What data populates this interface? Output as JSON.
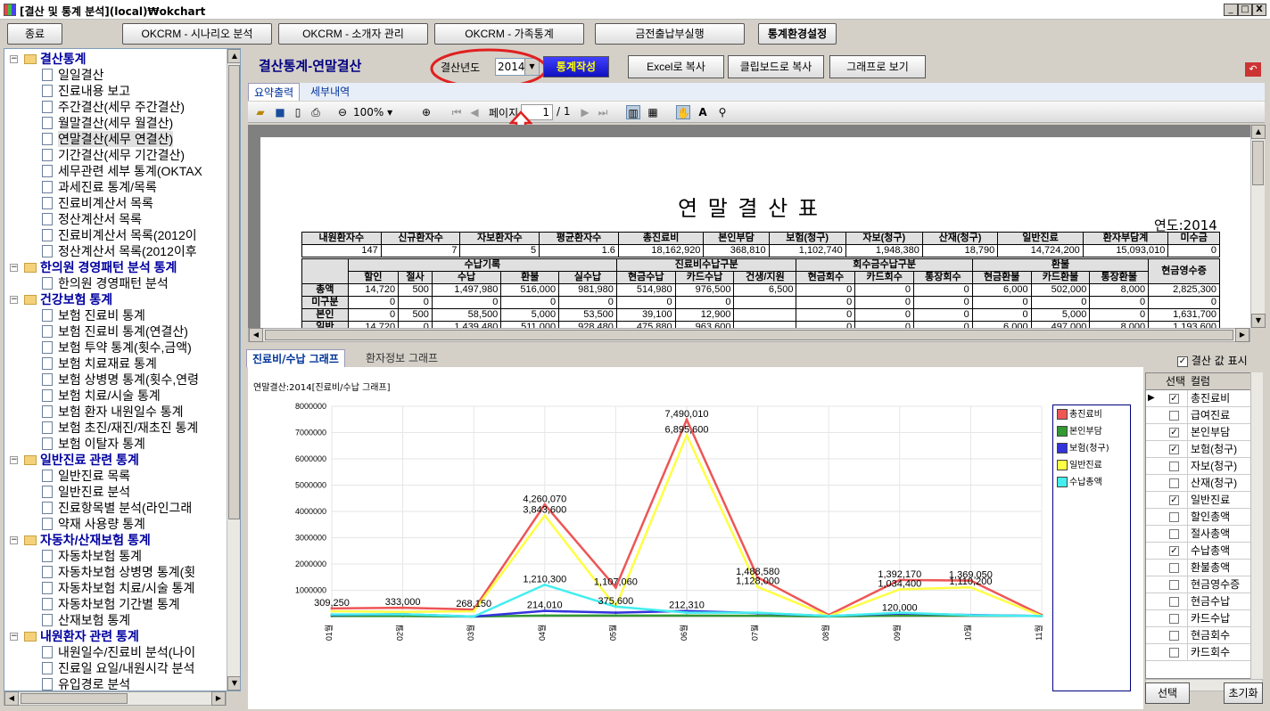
{
  "window": {
    "title": "[결산 및 통계 분석](local)₩okchart",
    "min": "_",
    "max": "□",
    "close": "X"
  },
  "topbar": {
    "exit": "종료",
    "scenario": "OKCRM - 시나리오 분석",
    "referrer": "OKCRM - 소개자 관리",
    "family": "OKCRM - 가족통계",
    "cash": "금전출납부실행",
    "settings": "통계환경설정"
  },
  "tree": [
    {
      "label": "결산통계",
      "level": 0
    },
    {
      "label": "일일결산",
      "level": 1
    },
    {
      "label": "진료내용 보고",
      "level": 1
    },
    {
      "label": "주간결산(세무 주간결산)",
      "level": 1
    },
    {
      "label": "월말결산(세무 월결산)",
      "level": 1
    },
    {
      "label": "연말결산(세무 연결산)",
      "level": 1,
      "selected": true
    },
    {
      "label": "기간결산(세무 기간결산)",
      "level": 1
    },
    {
      "label": "세무관련 세부 통계(OKTAX",
      "level": 1
    },
    {
      "label": "과세진료 통계/목록",
      "level": 1
    },
    {
      "label": "진료비계산서 목록",
      "level": 1
    },
    {
      "label": "정산계산서 목록",
      "level": 1
    },
    {
      "label": "진료비계산서 목록(2012이",
      "level": 1
    },
    {
      "label": "정산계산서 목록(2012이후",
      "level": 1
    },
    {
      "label": "한의원 경영패턴 분석 통계",
      "level": 0
    },
    {
      "label": "한의원 경영패턴 분석",
      "level": 1
    },
    {
      "label": "건강보험 통계",
      "level": 0
    },
    {
      "label": "보험 진료비 통계",
      "level": 1
    },
    {
      "label": "보험 진료비 통계(연결산)",
      "level": 1
    },
    {
      "label": "보험 투약 통계(횟수,금액)",
      "level": 1
    },
    {
      "label": "보험 치료재료 통계",
      "level": 1
    },
    {
      "label": "보험 상병명 통계(횟수,연령",
      "level": 1
    },
    {
      "label": "보험 치료/시술 통계",
      "level": 1
    },
    {
      "label": "보험 환자 내원일수 통계",
      "level": 1
    },
    {
      "label": "보험 초진/재진/재초진 통계",
      "level": 1
    },
    {
      "label": "보험 이탈자 통계",
      "level": 1
    },
    {
      "label": "일반진료 관련 통계",
      "level": 0
    },
    {
      "label": "일반진료 목록",
      "level": 1
    },
    {
      "label": "일반진료 분석",
      "level": 1
    },
    {
      "label": "진료항목별 분석(라인그래",
      "level": 1
    },
    {
      "label": "약재 사용량 통계",
      "level": 1
    },
    {
      "label": "자동차/산재보험 통계",
      "level": 0
    },
    {
      "label": "자동차보험 통계",
      "level": 1
    },
    {
      "label": "자동차보험 상병명 통계(횟",
      "level": 1
    },
    {
      "label": "자동차보험 치료/시술 통계",
      "level": 1
    },
    {
      "label": "자동차보험 기간별 통계",
      "level": 1
    },
    {
      "label": "산재보험 통계",
      "level": 1
    },
    {
      "label": "내원환자 관련 통계",
      "level": 0
    },
    {
      "label": "내원일수/진료비 분석(나이",
      "level": 1
    },
    {
      "label": "진료일 요일/내원시각 분석",
      "level": 1
    },
    {
      "label": "유입경로 분석",
      "level": 1
    }
  ],
  "header": {
    "title": "결산통계-연말결산",
    "year_label": "결산년도",
    "year_value": "2014",
    "make": "통계작성",
    "excel": "Excel로 복사",
    "clipboard": "클립보드로 복사",
    "graph": "그래프로 보기"
  },
  "report_tabs": [
    "요약출력",
    "세부내역"
  ],
  "viewer": {
    "zoom": "100%",
    "page_label": "페이지",
    "page_value": "1",
    "page_total": "/ 1"
  },
  "report": {
    "title": "연 말 결 산 표",
    "year": "연도:2014",
    "sum_headers": [
      "내원환자수",
      "신규환자수",
      "자보환자수",
      "평균환자수",
      "총진료비",
      "본인부담",
      "보험(청구)",
      "자보(청구)",
      "산재(청구)",
      "일반진료",
      "환자부담계",
      "미수금"
    ],
    "sum_values": [
      "147",
      "7",
      "5",
      "1.6",
      "18,162,920",
      "368,810",
      "1,102,740",
      "1,948,380",
      "18,790",
      "14,724,200",
      "15,093,010",
      "0"
    ],
    "group_headers": [
      "수납기록",
      "진료비수납구분",
      "회수금수납구분",
      "환불",
      "현금영수증"
    ],
    "sub_headers": [
      "할인",
      "절사",
      "수납",
      "환불",
      "실수납",
      "현금수납",
      "카드수납",
      "건생/지원",
      "현금회수",
      "카드회수",
      "통장회수",
      "현금환불",
      "카드환불",
      "통장환불"
    ],
    "rows": [
      {
        "label": "총액",
        "values": [
          "14,720",
          "500",
          "1,497,980",
          "516,000",
          "981,980",
          "514,980",
          "976,500",
          "6,500",
          "0",
          "0",
          "0",
          "6,000",
          "502,000",
          "8,000",
          "2,825,300"
        ]
      },
      {
        "label": "미구분",
        "values": [
          "0",
          "0",
          "0",
          "0",
          "0",
          "0",
          "0",
          "",
          "0",
          "0",
          "0",
          "0",
          "0",
          "0",
          "0"
        ]
      },
      {
        "label": "본인",
        "values": [
          "0",
          "500",
          "58,500",
          "5,000",
          "53,500",
          "39,100",
          "12,900",
          "",
          "0",
          "0",
          "0",
          "0",
          "5,000",
          "0",
          "1,631,700"
        ]
      },
      {
        "label": "일반",
        "values": [
          "14,720",
          "0",
          "1,439,480",
          "511,000",
          "928,480",
          "475,880",
          "963,600",
          "",
          "0",
          "0",
          "0",
          "6,000",
          "497,000",
          "8,000",
          "1,193,600"
        ]
      }
    ]
  },
  "chart_tabs": [
    "진료비/수납 그래프",
    "환자정보 그래프"
  ],
  "show_values_label": "결산 값 표시",
  "chart_data": {
    "type": "line",
    "title": "연말결산:2014[진료비/수납 그래프]",
    "categories": [
      "01월",
      "02월",
      "03월",
      "04월",
      "05월",
      "06월",
      "07월",
      "08월",
      "09월",
      "10월",
      "11월"
    ],
    "ylim": [
      0,
      8000000
    ],
    "yticks": [
      "1000000",
      "2000000",
      "3000000",
      "4000000",
      "5000000",
      "6000000",
      "7000000",
      "8000000"
    ],
    "series": [
      {
        "name": "총진료비",
        "color": "#ee5555",
        "values": [
          309250,
          333000,
          268150,
          4260070,
          1107060,
          7490010,
          1488580,
          59500,
          1392170,
          1369050,
          60000
        ]
      },
      {
        "name": "본인부담",
        "color": "#339933",
        "values": [
          20000,
          20000,
          0,
          40000,
          40000,
          40000,
          30000,
          5000,
          40000,
          40000,
          20000
        ]
      },
      {
        "name": "보험(청구)",
        "color": "#3333dd",
        "values": [
          60000,
          90000,
          0,
          214010,
          147000,
          212310,
          130000,
          20000,
          120000,
          60000,
          20000
        ]
      },
      {
        "name": "일반진료",
        "color": "#ffff44",
        "values": [
          200000,
          180000,
          200000,
          3843600,
          375600,
          6895600,
          1128000,
          15000,
          1034400,
          1110200,
          20000
        ]
      },
      {
        "name": "수납총액",
        "color": "#44eeee",
        "values": [
          80000,
          90000,
          0,
          1210300,
          375600,
          150000,
          150000,
          15000,
          150000,
          50000,
          20000
        ]
      }
    ],
    "labels": [
      {
        "text": "7,490,010",
        "x": "06월",
        "y": 7490010
      },
      {
        "text": "6,895,600",
        "x": "06월",
        "y": 6895600
      },
      {
        "text": "4,260,070",
        "x": "04월",
        "y": 4260070
      },
      {
        "text": "3,843,600",
        "x": "04월",
        "y": 3843600
      },
      {
        "text": "1,210,300",
        "x": "04월",
        "y": 1210300
      },
      {
        "text": "1,107,060",
        "x": "05월",
        "y": 1107060
      },
      {
        "text": "375,600",
        "x": "05월",
        "y": 375600
      },
      {
        "text": "1,488,580",
        "x": "07월",
        "y": 1488580
      },
      {
        "text": "1,128,000",
        "x": "07월",
        "y": 1128000
      },
      {
        "text": "1,392,170",
        "x": "09월",
        "y": 1392170
      },
      {
        "text": "1,034,400",
        "x": "09월",
        "y": 1034400
      },
      {
        "text": "1,369,050",
        "x": "10월",
        "y": 1369050
      },
      {
        "text": "1,110,200",
        "x": "10월",
        "y": 1110200
      },
      {
        "text": "309,250",
        "x": "01월",
        "y": 309250
      },
      {
        "text": "333,000",
        "x": "02월",
        "y": 333000
      },
      {
        "text": "268,150",
        "x": "03월",
        "y": 268150
      },
      {
        "text": "214,010",
        "x": "04월",
        "y": 214010
      },
      {
        "text": "212,310",
        "x": "06월",
        "y": 212310
      },
      {
        "text": "120,000",
        "x": "09월",
        "y": 120000
      }
    ]
  },
  "column_grid": {
    "header_select": "선택",
    "header_column": "컬럼",
    "rows": [
      {
        "name": "총진료비",
        "checked": true
      },
      {
        "name": "급여진료",
        "checked": false
      },
      {
        "name": "본인부담",
        "checked": true
      },
      {
        "name": "보험(청구)",
        "checked": true
      },
      {
        "name": "자보(청구)",
        "checked": false
      },
      {
        "name": "산재(청구)",
        "checked": false
      },
      {
        "name": "일반진료",
        "checked": true
      },
      {
        "name": "할인총액",
        "checked": false
      },
      {
        "name": "절사총액",
        "checked": false
      },
      {
        "name": "수납총액",
        "checked": true
      },
      {
        "name": "환불총액",
        "checked": false
      },
      {
        "name": "현금영수증",
        "checked": false
      },
      {
        "name": "현금수납",
        "checked": false
      },
      {
        "name": "카드수납",
        "checked": false
      },
      {
        "name": "현금회수",
        "checked": false
      },
      {
        "name": "카드회수",
        "checked": false
      }
    ]
  },
  "bottom": {
    "select": "선택",
    "reset": "초기화"
  }
}
